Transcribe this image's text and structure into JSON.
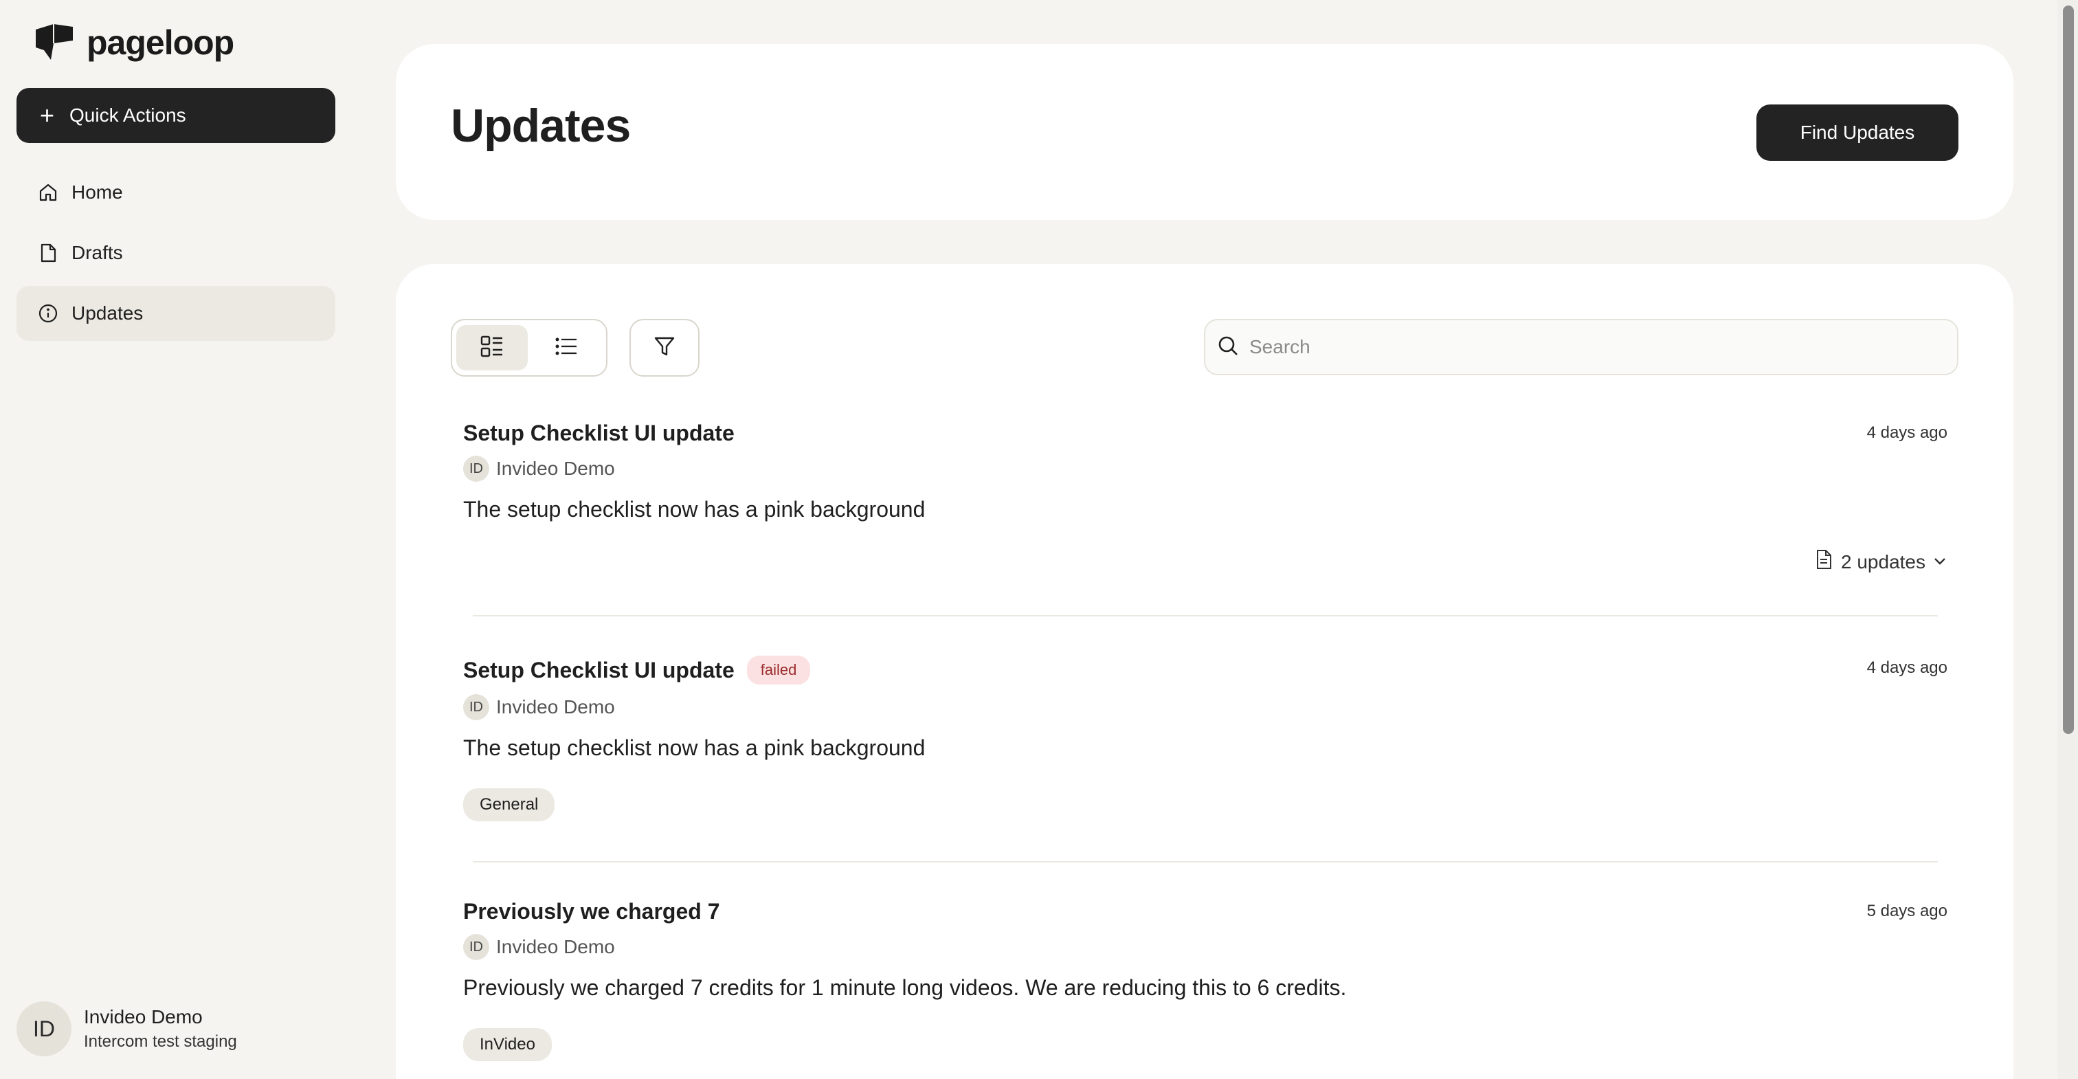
{
  "app": {
    "logo_text": "pageloop"
  },
  "sidebar": {
    "quick_actions_label": "Quick Actions",
    "items": [
      {
        "label": "Home",
        "icon": "home-icon"
      },
      {
        "label": "Drafts",
        "icon": "file-icon"
      },
      {
        "label": "Updates",
        "icon": "info-icon",
        "active": true
      }
    ],
    "user": {
      "initials": "ID",
      "name": "Invideo Demo",
      "workspace": "Intercom test staging"
    }
  },
  "header": {
    "title": "Updates",
    "find_button": "Find Updates"
  },
  "toolbar": {
    "search_placeholder": "Search",
    "view_modes": [
      "card-view",
      "list-view"
    ],
    "active_view": "card-view"
  },
  "updates": [
    {
      "title": "Setup Checklist UI update",
      "status": "",
      "author_initials": "ID",
      "author": "Invideo Demo",
      "body": "The setup checklist now has a pink background",
      "time": "4 days ago",
      "updates_count_label": "2 updates",
      "tag": ""
    },
    {
      "title": "Setup Checklist UI update",
      "status": "failed",
      "author_initials": "ID",
      "author": "Invideo Demo",
      "body": "The setup checklist now has a pink background",
      "time": "4 days ago",
      "tag": "General"
    },
    {
      "title": "Previously we charged 7",
      "status": "",
      "author_initials": "ID",
      "author": "Invideo Demo",
      "body": "Previously we charged 7 credits for 1 minute long videos. We are reducing this to 6 credits.",
      "time": "5 days ago",
      "tag": "InVideo"
    }
  ],
  "colors": {
    "primary_dark": "#232323",
    "page_bg": "#f5f4f0",
    "active_nav": "#ebe9e2",
    "failed_bg": "#fbe1e1",
    "failed_text": "#9b2c2c"
  }
}
